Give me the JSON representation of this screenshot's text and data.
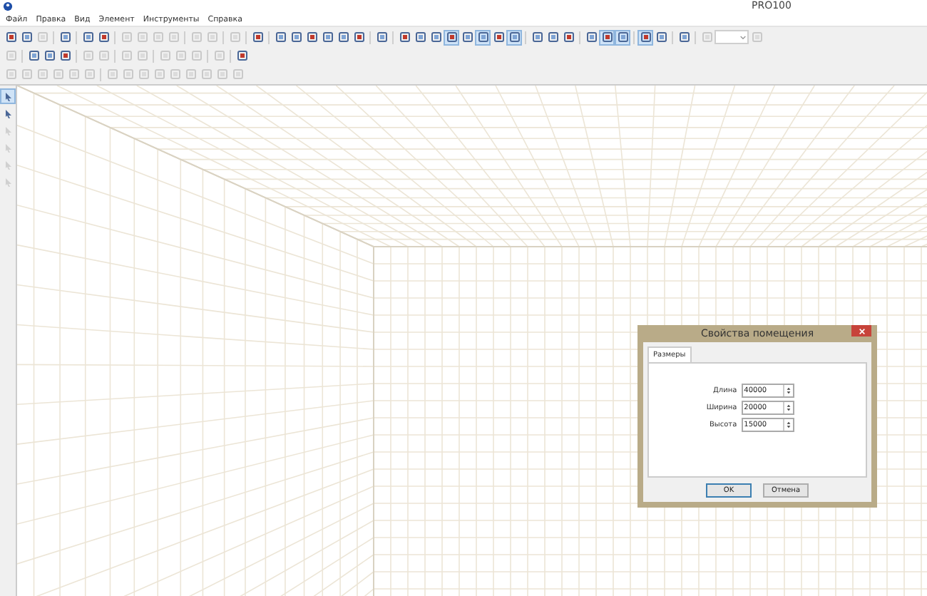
{
  "window": {
    "title": "PRO100"
  },
  "menu": [
    {
      "label": "Файл"
    },
    {
      "label": "Правка"
    },
    {
      "label": "Вид"
    },
    {
      "label": "Элемент"
    },
    {
      "label": "Инструменты"
    },
    {
      "label": "Справка"
    }
  ],
  "toolbars": [
    {
      "groups": [
        [
          {
            "kind": "button",
            "pressed": false,
            "disabled": false
          },
          {
            "kind": "button",
            "pressed": false,
            "disabled": false
          },
          {
            "kind": "button",
            "pressed": false,
            "disabled": true
          }
        ],
        [
          {
            "kind": "button",
            "pressed": false,
            "disabled": false
          }
        ],
        [
          {
            "kind": "button",
            "pressed": false,
            "disabled": false
          },
          {
            "kind": "button",
            "pressed": false,
            "disabled": false
          }
        ],
        [
          {
            "kind": "button",
            "pressed": false,
            "disabled": true
          },
          {
            "kind": "button",
            "pressed": false,
            "disabled": true
          },
          {
            "kind": "button",
            "pressed": false,
            "disabled": true
          },
          {
            "kind": "button",
            "pressed": false,
            "disabled": true
          }
        ],
        [
          {
            "kind": "button",
            "pressed": false,
            "disabled": true
          },
          {
            "kind": "button",
            "pressed": false,
            "disabled": true
          }
        ],
        [
          {
            "kind": "button",
            "pressed": false,
            "disabled": true
          }
        ],
        [
          {
            "kind": "button",
            "pressed": false,
            "disabled": false
          }
        ],
        [
          {
            "kind": "button",
            "pressed": false,
            "disabled": false
          },
          {
            "kind": "button",
            "pressed": false,
            "disabled": false
          },
          {
            "kind": "button",
            "pressed": false,
            "disabled": false
          },
          {
            "kind": "button",
            "pressed": false,
            "disabled": false
          },
          {
            "kind": "button",
            "pressed": false,
            "disabled": false
          },
          {
            "kind": "button",
            "pressed": false,
            "disabled": false
          }
        ],
        [
          {
            "kind": "button",
            "pressed": false,
            "disabled": false
          }
        ],
        [
          {
            "kind": "button",
            "pressed": false,
            "disabled": false
          },
          {
            "kind": "button",
            "pressed": false,
            "disabled": false
          },
          {
            "kind": "button",
            "pressed": false,
            "disabled": false
          },
          {
            "kind": "button",
            "pressed": true,
            "disabled": false
          },
          {
            "kind": "button",
            "pressed": false,
            "disabled": false
          },
          {
            "kind": "button",
            "pressed": true,
            "disabled": false
          },
          {
            "kind": "button",
            "pressed": false,
            "disabled": false
          },
          {
            "kind": "button",
            "pressed": true,
            "disabled": false
          }
        ],
        [
          {
            "kind": "button",
            "pressed": false,
            "disabled": false
          },
          {
            "kind": "button",
            "pressed": false,
            "disabled": false
          },
          {
            "kind": "button",
            "pressed": false,
            "disabled": false
          }
        ],
        [
          {
            "kind": "button",
            "pressed": false,
            "disabled": false
          },
          {
            "kind": "button",
            "pressed": true,
            "disabled": false
          },
          {
            "kind": "button",
            "pressed": true,
            "disabled": false
          }
        ],
        [
          {
            "kind": "button",
            "pressed": true,
            "disabled": false
          },
          {
            "kind": "button",
            "pressed": false,
            "disabled": false
          }
        ],
        [
          {
            "kind": "button",
            "pressed": false,
            "disabled": false
          }
        ],
        [
          {
            "kind": "button",
            "pressed": false,
            "disabled": true
          }
        ],
        [
          {
            "kind": "button",
            "pressed": false,
            "disabled": true
          }
        ]
      ]
    },
    {
      "groups": [
        [
          {
            "kind": "button",
            "pressed": false,
            "disabled": true
          }
        ],
        [
          {
            "kind": "button",
            "pressed": false,
            "disabled": false
          },
          {
            "kind": "button",
            "pressed": false,
            "disabled": false
          },
          {
            "kind": "button",
            "pressed": false,
            "disabled": false
          }
        ],
        [
          {
            "kind": "button",
            "pressed": false,
            "disabled": true
          },
          {
            "kind": "button",
            "pressed": false,
            "disabled": true
          }
        ],
        [
          {
            "kind": "button",
            "pressed": false,
            "disabled": true
          },
          {
            "kind": "button",
            "pressed": false,
            "disabled": true
          }
        ],
        [
          {
            "kind": "button",
            "pressed": false,
            "disabled": true
          },
          {
            "kind": "button",
            "pressed": false,
            "disabled": true
          },
          {
            "kind": "button",
            "pressed": false,
            "disabled": true
          }
        ],
        [
          {
            "kind": "button",
            "pressed": false,
            "disabled": true
          }
        ],
        [
          {
            "kind": "button",
            "pressed": false,
            "disabled": false
          }
        ]
      ]
    },
    {
      "groups": [
        [
          {
            "kind": "button",
            "pressed": false,
            "disabled": true
          },
          {
            "kind": "button",
            "pressed": false,
            "disabled": true
          },
          {
            "kind": "button",
            "pressed": false,
            "disabled": true
          },
          {
            "kind": "button",
            "pressed": false,
            "disabled": true
          },
          {
            "kind": "button",
            "pressed": false,
            "disabled": true
          },
          {
            "kind": "button",
            "pressed": false,
            "disabled": true
          }
        ],
        [
          {
            "kind": "button",
            "pressed": false,
            "disabled": true
          },
          {
            "kind": "button",
            "pressed": false,
            "disabled": true
          },
          {
            "kind": "button",
            "pressed": false,
            "disabled": true
          },
          {
            "kind": "button",
            "pressed": false,
            "disabled": true
          },
          {
            "kind": "button",
            "pressed": false,
            "disabled": true
          },
          {
            "kind": "button",
            "pressed": false,
            "disabled": true
          },
          {
            "kind": "button",
            "pressed": false,
            "disabled": true
          },
          {
            "kind": "button",
            "pressed": false,
            "disabled": true
          },
          {
            "kind": "button",
            "pressed": false,
            "disabled": true
          }
        ]
      ]
    }
  ],
  "side_toolbar": [
    {
      "pressed": true,
      "disabled": false
    },
    {
      "pressed": false,
      "disabled": false
    },
    {
      "pressed": false,
      "disabled": true
    },
    {
      "pressed": false,
      "disabled": true
    },
    {
      "pressed": false,
      "disabled": true
    },
    {
      "pressed": false,
      "disabled": true
    }
  ],
  "dialog": {
    "title": "Свойства помещения",
    "tabs": [
      {
        "label": "Размеры",
        "selected": true
      }
    ],
    "fields": [
      {
        "label": "Длина",
        "value": "40000"
      },
      {
        "label": "Ширина",
        "value": "20000"
      },
      {
        "label": "Высота",
        "value": "15000"
      }
    ],
    "buttons": [
      {
        "label": "OK",
        "default": true
      },
      {
        "label": "Отмена",
        "default": false
      }
    ]
  }
}
